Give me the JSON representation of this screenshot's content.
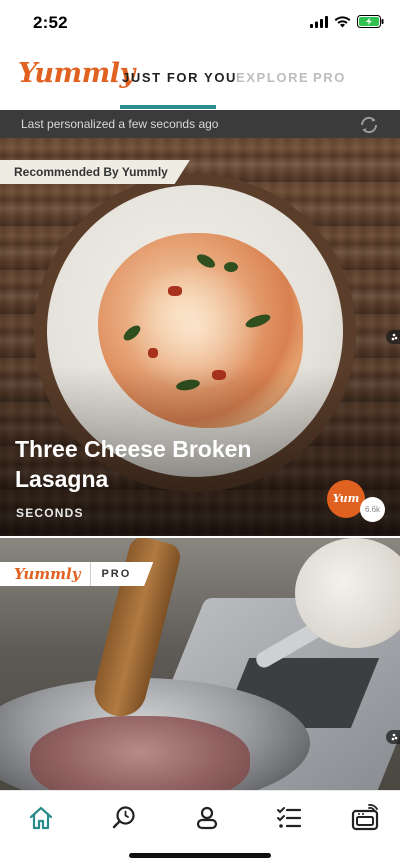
{
  "status_bar": {
    "time": "2:52",
    "icons": [
      "signal-icon",
      "wifi-icon",
      "battery-charging-icon"
    ]
  },
  "header": {
    "logo": "Yummly",
    "tabs": [
      {
        "label": "JUST FOR YOU",
        "active": true
      },
      {
        "label": "EXPLORE",
        "active": false
      },
      {
        "label": "PRO",
        "active": false
      }
    ]
  },
  "personalized": {
    "text": "Last personalized a few seconds ago",
    "icon": "refresh-icon"
  },
  "hero_card": {
    "tag": "Recommended By Yummly",
    "title": "Three Cheese Broken Lasagna",
    "time": "SECONDS",
    "yum_label": "Yum",
    "yum_count": "6.6k"
  },
  "pro_card": {
    "logo": "Yummly",
    "badge": "PRO"
  },
  "bottom_nav": {
    "items": [
      "home-icon",
      "search-icon",
      "profile-icon",
      "shopping-list-icon",
      "smart-appliance-icon"
    ]
  },
  "colors": {
    "brand": "#e16120",
    "tab_indicator": "#2b8c8c",
    "nav_active": "#2b8c8c"
  }
}
